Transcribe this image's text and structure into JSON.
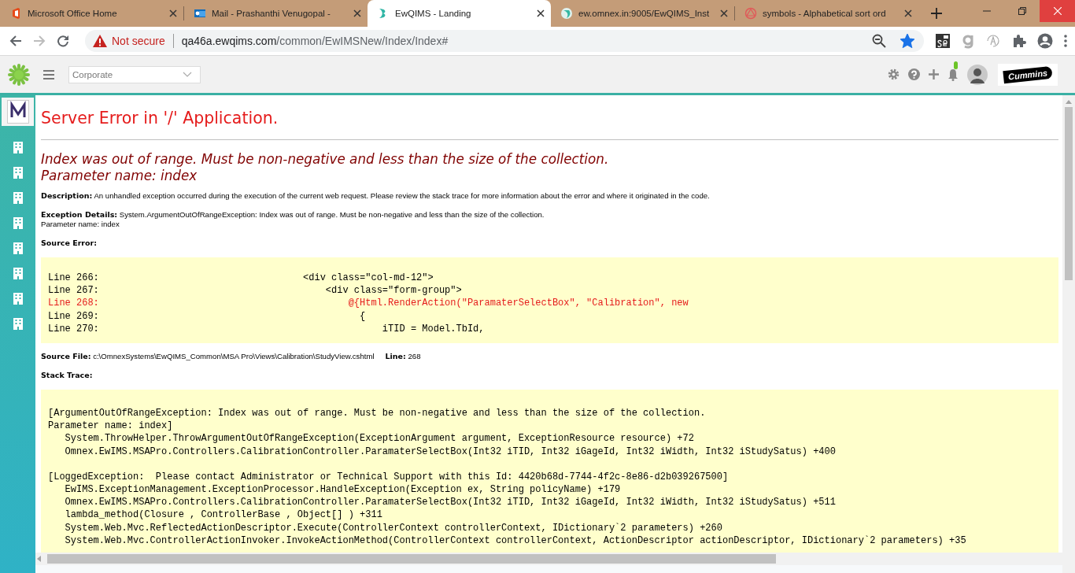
{
  "browser": {
    "tabs": [
      {
        "title": "Microsoft Office Home",
        "kind": "office",
        "selected": false
      },
      {
        "title": "Mail - Prashanthi Venugopal -",
        "kind": "mail",
        "selected": false
      },
      {
        "title": "EwQIMS - Landing",
        "kind": "ewqims",
        "selected": true
      },
      {
        "title": "ew.omnex.in:9005/EwQIMS_Inst",
        "kind": "omnex",
        "selected": false
      },
      {
        "title": "symbols - Alphabetical sort ord",
        "kind": "symbols",
        "selected": false
      }
    ],
    "security_label": "Not secure",
    "url": "qa46a.ewqims.com/common/EwIMSNew/Index/Index#",
    "bookmarked": true
  },
  "app": {
    "unit_select": {
      "value": "Corporate"
    },
    "notification": true,
    "logo_text": "Cummins"
  },
  "sidebar": {
    "items": [
      {
        "kind": "building"
      },
      {
        "kind": "building"
      },
      {
        "kind": "building"
      },
      {
        "kind": "building"
      },
      {
        "kind": "building"
      },
      {
        "kind": "building"
      },
      {
        "kind": "building"
      },
      {
        "kind": "building"
      }
    ]
  },
  "error": {
    "title": "Server Error in '/' Application.",
    "message": [
      "Index was out of range. Must be non-negative and less than the size of the collection.",
      "Parameter name: index"
    ],
    "description": {
      "label": "Description:",
      "text": "An unhandled exception occurred during the execution of the current web request. Please review the stack trace for more information about the error and where it originated in the code."
    },
    "exception_details": {
      "label": "Exception Details:",
      "text": "System.ArgumentOutOfRangeException: Index was out of range. Must be non-negative and less than the size of the collection.",
      "parameter": "Parameter name: index"
    },
    "source_error": {
      "label": "Source Error:",
      "lines": [
        {
          "number": "Line 266:",
          "code": "                                    <div class=\"col-md-12\">",
          "highlighted": false
        },
        {
          "number": "Line 267:",
          "code": "                                        <div class=\"form-group\">",
          "highlighted": false
        },
        {
          "number": "Line 268:",
          "code": "                                            @{Html.RenderAction(\"ParamaterSelectBox\", \"Calibration\", new",
          "highlighted": true
        },
        {
          "number": "Line 269:",
          "code": "                                              {",
          "highlighted": false
        },
        {
          "number": "Line 270:",
          "code": "                                                  iTID = Model.TbId,",
          "highlighted": false
        }
      ]
    },
    "source_file": {
      "label": "Source File:",
      "value": "c:\\OmnexSystems\\EwQIMS_Common\\MSA Pro\\Views\\Calibration\\StudyView.cshtml",
      "line_label": "Line:",
      "line_value": "268"
    },
    "stack_trace": {
      "label": "Stack Trace:",
      "blocks": [
        [
          "[ArgumentOutOfRangeException: Index was out of range. Must be non-negative and less than the size of the collection.",
          "Parameter name: index]",
          "   System.ThrowHelper.ThrowArgumentOutOfRangeException(ExceptionArgument argument, ExceptionResource resource) +72",
          "   Omnex.EwIMS.MSAPro.Controllers.CalibrationController.ParamaterSelectBox(Int32 iTID, Int32 iGageId, Int32 iWidth, Int32 iStudySatus) +400"
        ],
        [
          "[LoggedException:  Please contact Administrator or Technical Support with this Id: 4420b68d-7744-4f2c-8e86-d2b039267500]",
          "   EwIMS.ExceptionManagement.ExceptionProcessor.HandleException(Exception ex, String policyName) +179",
          "   Omnex.EwIMS.MSAPro.Controllers.CalibrationController.ParamaterSelectBox(Int32 iTID, Int32 iGageId, Int32 iWidth, Int32 iStudySatus) +511",
          "   lambda_method(Closure , ControllerBase , Object[] ) +311",
          "   System.Web.Mvc.ReflectedActionDescriptor.Execute(ControllerContext controllerContext, IDictionary`2 parameters) +260",
          "   System.Web.Mvc.ControllerActionInvoker.InvokeActionMethod(ControllerContext controllerContext, ActionDescriptor actionDescriptor, IDictionary`2 parameters) +35"
        ]
      ]
    }
  }
}
